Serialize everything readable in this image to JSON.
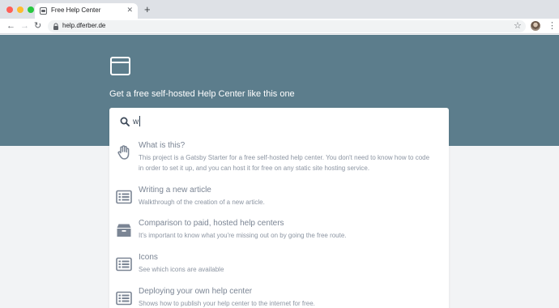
{
  "browser": {
    "tab_title": "Free Help Center",
    "tab_close": "✕",
    "new_tab": "+",
    "back": "←",
    "forward": "→",
    "reload": "↻",
    "url": "help.dferber.de",
    "bookmark": "☆",
    "menu": "⋮",
    "dots": [
      "#ff5f57",
      "#febc2e",
      "#28c840"
    ]
  },
  "hero": {
    "tagline": "Get a free self-hosted Help Center like this one"
  },
  "search": {
    "value": "w"
  },
  "results": [
    {
      "icon": "hand-icon",
      "title": "What is this?",
      "description": "This project is a Gatsby Starter for a free self-hosted help center. You don't need to know how to code in order to set it up, and you can host it for free on any static site hosting service."
    },
    {
      "icon": "list-icon",
      "title": "Writing a new article",
      "description": "Walkthrough of the creation of a new article."
    },
    {
      "icon": "box-icon",
      "title": "Comparison to paid, hosted help centers",
      "description": "It's important to know what you're missing out on by going the free route."
    },
    {
      "icon": "list-icon",
      "title": "Icons",
      "description": "See which icons are available"
    },
    {
      "icon": "list-icon",
      "title": "Deploying your own help center",
      "description": "Shows how to publish your help center to the internet for free."
    }
  ],
  "colors": {
    "hero_bg": "#5c7d8c",
    "icon": "#7b8594"
  }
}
